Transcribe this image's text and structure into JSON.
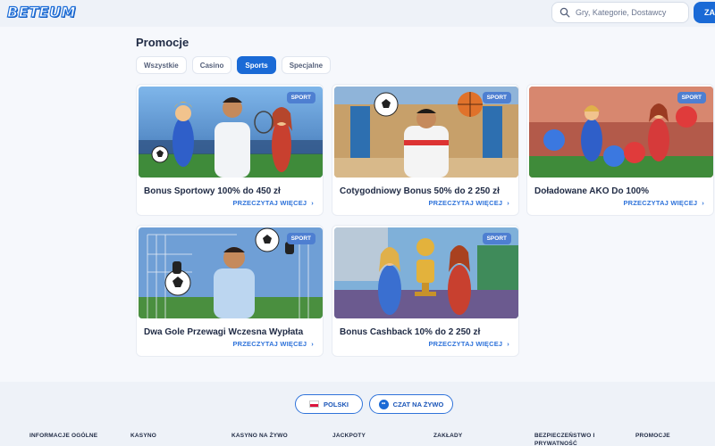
{
  "header": {
    "logo": "BETEUM",
    "search_placeholder": "Gry, Kategorie, Dostawcy",
    "login_label": "ZA"
  },
  "page": {
    "title": "Promocje",
    "tabs": [
      {
        "label": "Wszystkie",
        "active": false
      },
      {
        "label": "Casino",
        "active": false
      },
      {
        "label": "Sports",
        "active": true
      },
      {
        "label": "Specjalne",
        "active": false
      }
    ]
  },
  "promotions": [
    {
      "title": "Bonus Sportowy 100% do 450 zł",
      "badge": "SPORT",
      "link": "PRZECZYTAJ WIĘCEJ"
    },
    {
      "title": "Cotygodniowy Bonus 50% do 2 250 zł",
      "badge": "SPORT",
      "link": "PRZECZYTAJ WIĘCEJ"
    },
    {
      "title": "Doładowane AKO Do 100%",
      "badge": "SPORT",
      "link": "PRZECZYTAJ WIĘCEJ"
    },
    {
      "title": "Dwa Gole Przewagi Wczesna Wypłata",
      "badge": "SPORT",
      "link": "PRZECZYTAJ WIĘCEJ"
    },
    {
      "title": "Bonus Cashback 10% do 2 250 zł",
      "badge": "SPORT",
      "link": "PRZECZYTAJ WIĘCEJ"
    }
  ],
  "footer": {
    "language_label": "POLSKI",
    "chat_label": "CZAT NA ŻYWO",
    "columns": [
      "INFORMACJE OGÓLNE",
      "KASYNO",
      "KASYNO NA ŻYWO",
      "JACKPOTY",
      "ZAKŁADY",
      "BEZPIECZEŃSTWO I PRYWATNOŚĆ",
      "PROMOCJE"
    ]
  },
  "colors": {
    "accent": "#1a6ad6",
    "link": "#2f73da",
    "badge": "#4e7fd1",
    "background": "#eef2f8"
  }
}
